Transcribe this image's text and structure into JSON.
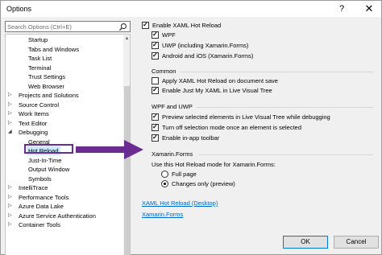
{
  "window": {
    "title": "Options",
    "help_glyph": "?",
    "close_glyph": "✕"
  },
  "search": {
    "placeholder": "Search Options (Ctrl+E)"
  },
  "tree": {
    "items": [
      {
        "label": "Startup",
        "level": "child"
      },
      {
        "label": "Tabs and Windows",
        "level": "child"
      },
      {
        "label": "Task List",
        "level": "child"
      },
      {
        "label": "Terminal",
        "level": "child"
      },
      {
        "label": "Trust Settings",
        "level": "child"
      },
      {
        "label": "Web Browser",
        "level": "child"
      },
      {
        "label": "Projects and Solutions",
        "level": "top",
        "expanded": false
      },
      {
        "label": "Source Control",
        "level": "top",
        "expanded": false
      },
      {
        "label": "Work Items",
        "level": "top",
        "expanded": false
      },
      {
        "label": "Text Editor",
        "level": "top",
        "expanded": false
      },
      {
        "label": "Debugging",
        "level": "top",
        "expanded": true
      },
      {
        "label": "General",
        "level": "child"
      },
      {
        "label": "Hot Reload",
        "level": "child",
        "selected": true
      },
      {
        "label": "Just-In-Time",
        "level": "child"
      },
      {
        "label": "Output Window",
        "level": "child"
      },
      {
        "label": "Symbols",
        "level": "child"
      },
      {
        "label": "IntelliTrace",
        "level": "top",
        "expanded": false
      },
      {
        "label": "Performance Tools",
        "level": "top",
        "expanded": false
      },
      {
        "label": "Azure Data Lake",
        "level": "top",
        "expanded": false
      },
      {
        "label": "Azure Service Authentication",
        "level": "top",
        "expanded": false
      },
      {
        "label": "Container Tools",
        "level": "top",
        "expanded": false
      }
    ]
  },
  "settings": {
    "enable_xaml_hot_reload": {
      "label": "Enable XAML Hot Reload",
      "checked": true
    },
    "wpf": {
      "label": "WPF",
      "checked": true
    },
    "uwp": {
      "label": "UWP (including Xamarin.Forms)",
      "checked": true
    },
    "android_ios": {
      "label": "Android and iOS (Xamarin.Forms)",
      "checked": true
    },
    "common_title": "Common",
    "apply_on_save": {
      "label": "Apply XAML Hot Reload on document save",
      "checked": false
    },
    "just_my_xaml": {
      "label": "Enable Just My XAML in Live Visual Tree",
      "checked": true
    },
    "wpf_uwp_title": "WPF and UWP",
    "preview_selected": {
      "label": "Preview selected elements in Live Visual Tree while debugging",
      "checked": true
    },
    "turn_off_selection": {
      "label": "Turn off selection mode once an element is selected",
      "checked": true
    },
    "enable_toolbar": {
      "label": "Enable in-app toolbar",
      "checked": true
    },
    "xamarin_title": "Xamarin.Forms",
    "mode_prompt": "Use this Hot Reload mode for Xamarin.Forms:",
    "full_page": {
      "label": "Full page",
      "selected": false
    },
    "changes_only": {
      "label": "Changes only (preview)",
      "selected": true
    },
    "link_desktop": "XAML Hot Reload (Desktop)",
    "link_xamarin": "Xamarin.Forms"
  },
  "buttons": {
    "ok": "OK",
    "cancel": "Cancel"
  },
  "colors": {
    "annotation": "#6b2c91",
    "link": "#0066cc",
    "selection": "#cce8ff"
  }
}
